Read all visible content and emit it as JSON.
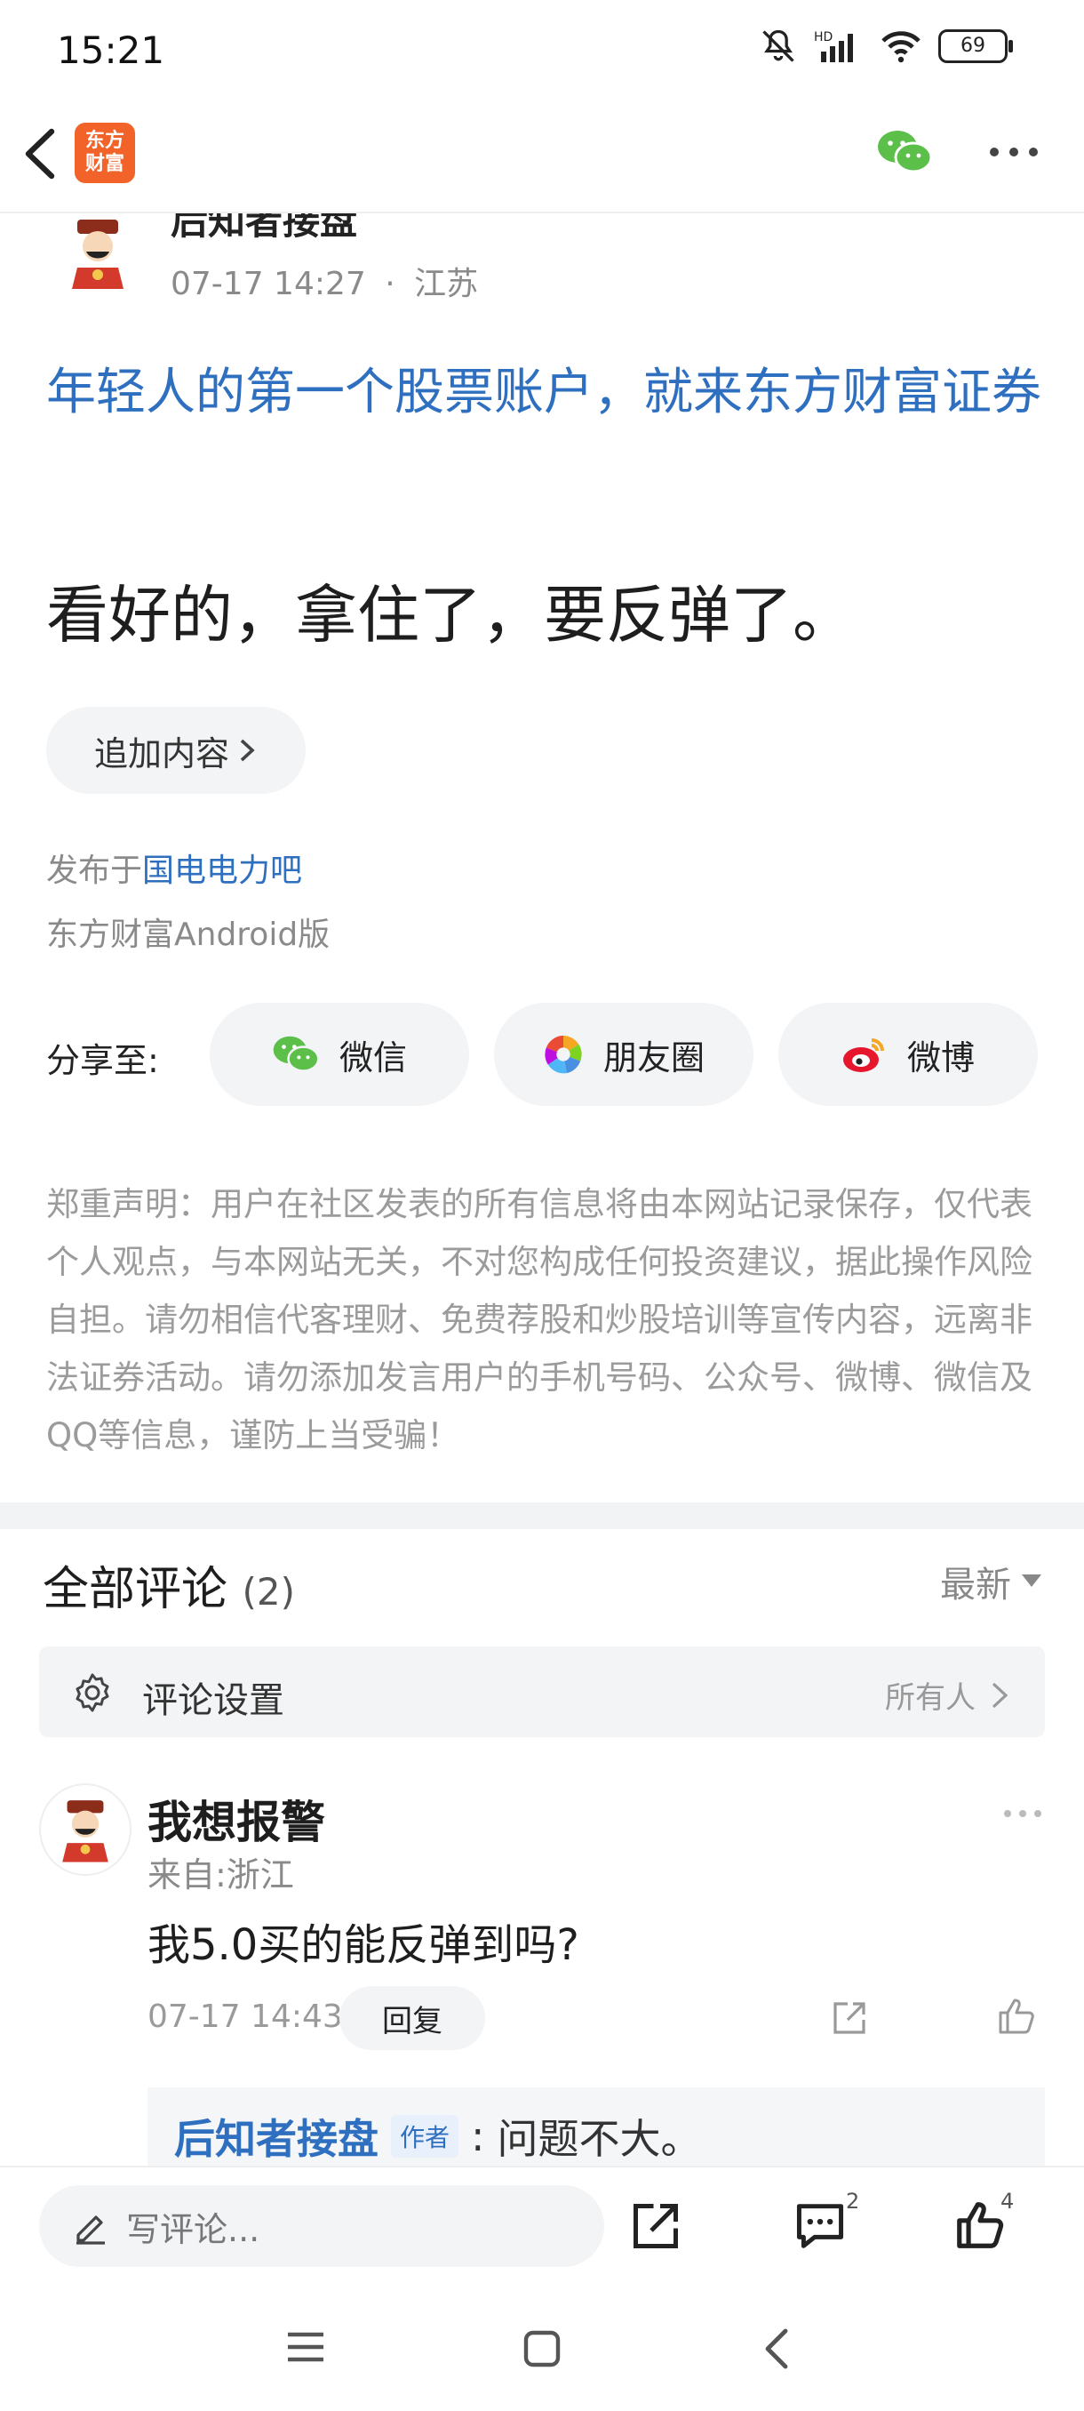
{
  "status_bar": {
    "time": "15:21",
    "battery": "69",
    "icons": [
      "mute-bell-icon",
      "hd-signal-icon",
      "wifi-icon",
      "battery-icon"
    ]
  },
  "header": {
    "back_icon": "back-arrow-icon",
    "logo_text_line1": "东方",
    "logo_text_line2": "财富",
    "wechat_icon": "wechat-icon",
    "more_icon": "more-dots-icon"
  },
  "post": {
    "author": "后知者接盘",
    "time": "07-17 14:27",
    "separator": "·",
    "location": "江苏",
    "ad_link": "年轻人的第一个股票账户，就来东方财富证券",
    "body": "看好的，拿住了，要反弹了。",
    "add_more_label": "追加内容",
    "published_prefix": "发布于",
    "published_bar": "国电电力吧",
    "client": "东方财富Android版"
  },
  "share": {
    "label": "分享至:",
    "buttons": [
      {
        "label": "微信",
        "icon": "wechat-icon"
      },
      {
        "label": "朋友圈",
        "icon": "moments-icon"
      },
      {
        "label": "微博",
        "icon": "weibo-icon"
      }
    ]
  },
  "disclaimer": "郑重声明：用户在社区发表的所有信息将由本网站记录保存，仅代表个人观点，与本网站无关，不对您构成任何投资建议，据此操作风险自担。请勿相信代客理财、免费荐股和炒股培训等宣传内容，远离非法证券活动。请勿添加发言用户的手机号码、公众号、微博、微信及QQ等信息，谨防上当受骗！",
  "comments": {
    "title": "全部评论",
    "count": "(2)",
    "sort_label": "最新",
    "settings_label": "评论设置",
    "settings_value": "所有人",
    "items": [
      {
        "name": "我想报警",
        "from": "来自:浙江",
        "text": "我5.0买的能反弹到吗?",
        "time": "07-17 14:43",
        "reply_label": "回复",
        "sub_reply": {
          "name": "后知者接盘",
          "tag": "作者",
          "text": "问题不大。"
        }
      }
    ]
  },
  "bottom_bar": {
    "write_placeholder": "写评论...",
    "comment_count": "2",
    "like_count": "4"
  },
  "colors": {
    "link_blue": "#2f6fbf",
    "brand_orange": "#f2632a",
    "wechat_green": "#5bbf4a",
    "weibo_red": "#e6162d"
  }
}
